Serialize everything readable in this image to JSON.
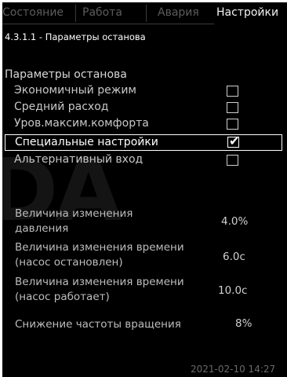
{
  "tabs": [
    {
      "label": "Состояние",
      "active": false
    },
    {
      "label": "Работа",
      "active": false
    },
    {
      "label": "Авария",
      "active": false
    },
    {
      "label": "Настройки",
      "active": true
    }
  ],
  "page_title": "4.3.1.1 - Параметры останова",
  "section_label": "Параметры останова",
  "options": [
    {
      "label": "Экономичный режим",
      "checked": false
    },
    {
      "label": "Средний расход",
      "checked": false
    },
    {
      "label": "Уров.максим.комфорта",
      "checked": false
    },
    {
      "label": "Специальные настройки",
      "checked": true,
      "selected": true
    },
    {
      "label": "Альтернативный вход",
      "checked": false
    }
  ],
  "parameters": [
    {
      "line1": "Величина изменения",
      "line2": "давления",
      "value": "4.0%"
    },
    {
      "line1": "Величина изменения времени",
      "line2": "(насос остановлен)",
      "value": "6.0с"
    },
    {
      "line1": "Величина изменения времени",
      "line2": "(насос работает)",
      "value": "10.0с"
    },
    {
      "line1": "Снижение частоты вращения",
      "line2": "",
      "value": "8%"
    }
  ],
  "datetime": "2021-02-10 14:27",
  "watermark": "DA",
  "colors": {
    "background": "#000000",
    "text": "#ffffff",
    "inactive_tab": "#5c5c5c"
  }
}
